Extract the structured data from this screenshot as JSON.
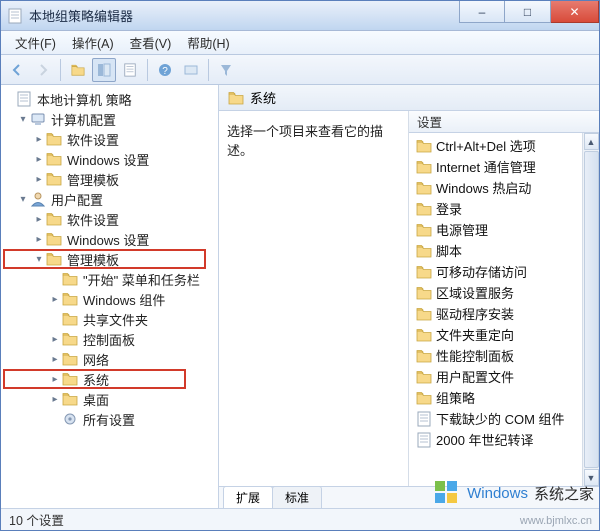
{
  "window": {
    "title": "本地组策略编辑器",
    "buttons": {
      "min": "–",
      "max": "□",
      "close": "✕"
    }
  },
  "menubar": {
    "file": "文件(F)",
    "action": "操作(A)",
    "view": "查看(V)",
    "help": "帮助(H)"
  },
  "tree": {
    "root": "本地计算机 策略",
    "computer_config": "计算机配置",
    "cc_software": "软件设置",
    "cc_windows": "Windows 设置",
    "cc_admin": "管理模板",
    "user_config": "用户配置",
    "uc_software": "软件设置",
    "uc_windows": "Windows 设置",
    "uc_admin": "管理模板",
    "start_menu": "\"开始\" 菜单和任务栏",
    "win_components": "Windows 组件",
    "shared_folders": "共享文件夹",
    "control_panel": "控制面板",
    "network": "网络",
    "system": "系统",
    "desktop": "桌面",
    "all_settings": "所有设置"
  },
  "right": {
    "header": "系统",
    "description": "选择一个项目来查看它的描述。",
    "column_settings": "设置",
    "items": {
      "ctrlaltdel": "Ctrl+Alt+Del 选项",
      "internet": "Internet 通信管理",
      "hotboot": "Windows 热启动",
      "logon": "登录",
      "power": "电源管理",
      "scripts": "脚本",
      "removable": "可移动存储访问",
      "locale": "区域设置服务",
      "driver": "驱动程序安装",
      "folder_redir": "文件夹重定向",
      "perf_cpl": "性能控制面板",
      "user_profile": "用户配置文件",
      "gpolicy": "组策略",
      "download_com": "下载缺少的 COM 组件",
      "y2k": "2000 年世纪转译"
    },
    "tabs": {
      "extended": "扩展",
      "standard": "标准"
    }
  },
  "statusbar": {
    "text": "10 个设置"
  },
  "watermark": {
    "brand1": "Windows",
    "brand2": "系统之家",
    "url": "www.bjmlxc.cn"
  }
}
